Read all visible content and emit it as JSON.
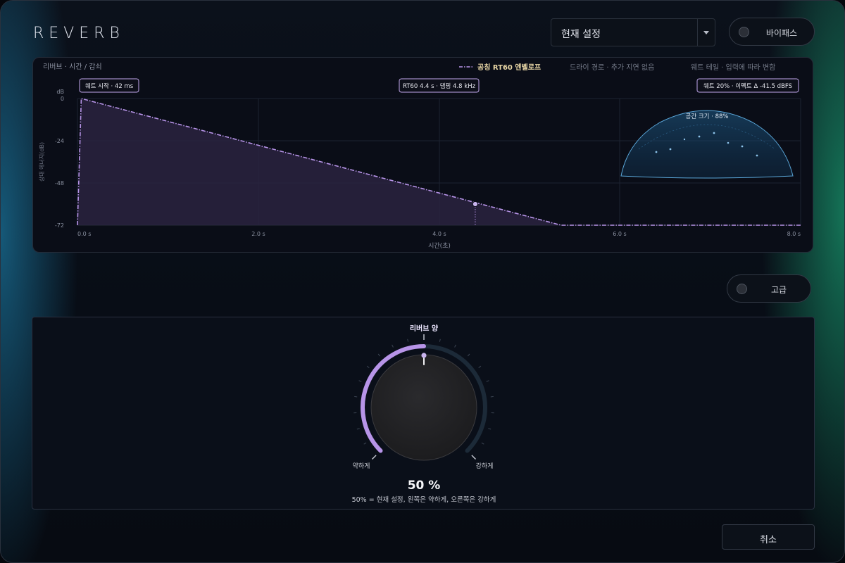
{
  "app": {
    "title": "REVERB"
  },
  "preset": {
    "value": "현재 설정"
  },
  "bypass": {
    "label": "바이패스"
  },
  "advanced": {
    "label": "고급"
  },
  "cancel": {
    "label": "취소"
  },
  "graph": {
    "section_title": "리버브 · 시간 / 감쇠",
    "legend_envelope": "공칭 RT60 엔벨로프",
    "legend_dry": "드라이 경로 · 추가 지연 없음",
    "legend_wet": "웨트 테일 · 입력에 따라 변함",
    "badge_predelay": "웨트 시작 · 42 ms",
    "badge_rt60": "RT60 4.4 s · 댐핑 4.8 kHz",
    "badge_wet": "웨트 20% · 이펙트 Δ -41.5 dBFS",
    "room_size_label": "공간 크기 · 88%",
    "y_unit": "dB",
    "y_label": "상대 에너지(dB)",
    "x_label": "시간(초)",
    "y_ticks": [
      "0",
      "-24",
      "-48",
      "-72"
    ],
    "x_ticks": [
      "0.0 s",
      "2.0 s",
      "4.0 s",
      "6.0 s",
      "8.0 s"
    ]
  },
  "chart_data": {
    "type": "line",
    "x_range": [
      0,
      8
    ],
    "y_range": [
      -72,
      0
    ],
    "series": [
      {
        "name": "공칭 RT60 엔벨로프",
        "x": [
          0.0,
          0.042,
          5.35,
          8.0
        ],
        "y": [
          -72,
          0,
          -72,
          -72
        ]
      }
    ],
    "marker": {
      "x": 4.4,
      "y": -60
    }
  },
  "room_size": {
    "percent": 88
  },
  "knob": {
    "title": "리버브 양",
    "min_label": "약하게",
    "max_label": "강하게",
    "value_text": "50 %",
    "value": 0.5,
    "caption": "50% = 현재 설정, 왼쪽은 약하게, 오른쪽은 강하게"
  },
  "colors": {
    "accent": "#b794e8",
    "envelope_fill": "#2a2340",
    "room_stroke": "#5aa6d8",
    "badge_border": "#c3a8ee",
    "legend_text": "#e9d7a6"
  }
}
